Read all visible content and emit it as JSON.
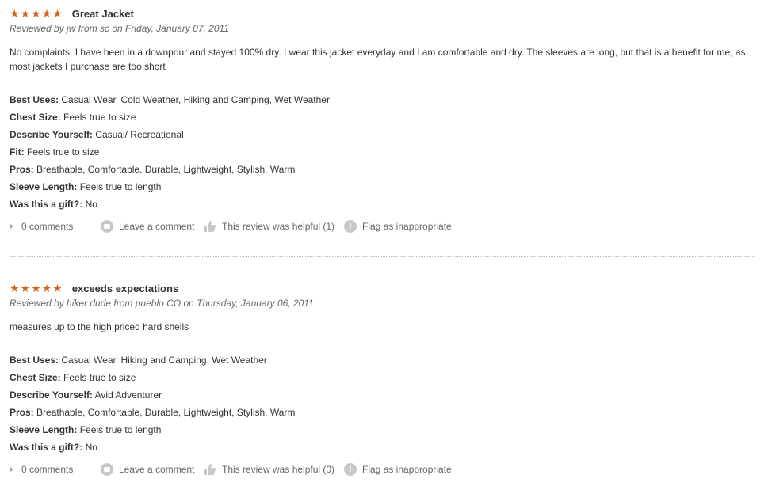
{
  "reviews": [
    {
      "stars": "★★★★★",
      "title": "Great Jacket",
      "byline": "Reviewed by jw from sc on Friday, January 07, 2011",
      "body": "No complaints. I have been in a downpour and stayed 100% dry. I wear this jacket everyday and I am comfortable and dry. The sleeves are long, but that is a benefit for me, as most jackets I purchase are too short",
      "attributes": [
        {
          "label": "Best Uses:",
          "value": " Casual Wear, Cold Weather, Hiking and Camping, Wet Weather"
        },
        {
          "label": "Chest Size:",
          "value": " Feels true to size"
        },
        {
          "label": "Describe Yourself:",
          "value": " Casual/ Recreational"
        },
        {
          "label": "Fit:",
          "value": " Feels true to size"
        },
        {
          "label": "Pros:",
          "value": " Breathable, Comfortable, Durable, Lightweight, Stylish, Warm"
        },
        {
          "label": "Sleeve Length:",
          "value": " Feels true to length"
        },
        {
          "label": "Was this a gift?:",
          "value": " No"
        }
      ],
      "comments": "0 comments",
      "leave_comment": "Leave a comment",
      "helpful": "This review was helpful (1)",
      "flag": "Flag as inappropriate"
    },
    {
      "stars": "★★★★★",
      "title": "exceeds expectations",
      "byline": "Reviewed by hiker dude from pueblo CO on Thursday, January 06, 2011",
      "body": "measures up to the high priced hard shells",
      "attributes": [
        {
          "label": "Best Uses:",
          "value": " Casual Wear, Hiking and Camping, Wet Weather"
        },
        {
          "label": "Chest Size:",
          "value": " Feels true to size"
        },
        {
          "label": "Describe Yourself:",
          "value": " Avid Adventurer"
        },
        {
          "label": "Pros:",
          "value": " Breathable, Comfortable, Durable, Lightweight, Stylish, Warm"
        },
        {
          "label": "Sleeve Length:",
          "value": " Feels true to length"
        },
        {
          "label": "Was this a gift?:",
          "value": " No"
        }
      ],
      "comments": "0 comments",
      "leave_comment": "Leave a comment",
      "helpful": "This review was helpful (0)",
      "flag": "Flag as inappropriate"
    }
  ],
  "colors": {
    "star": "#d4641c",
    "text": "#333333",
    "muted": "#666666",
    "icon": "#c8c8c8"
  },
  "icons": {
    "comments": "triangle-arrow-icon",
    "leave_comment": "speech-bubble-icon",
    "helpful": "thumbs-up-icon",
    "flag": "exclamation-icon"
  }
}
